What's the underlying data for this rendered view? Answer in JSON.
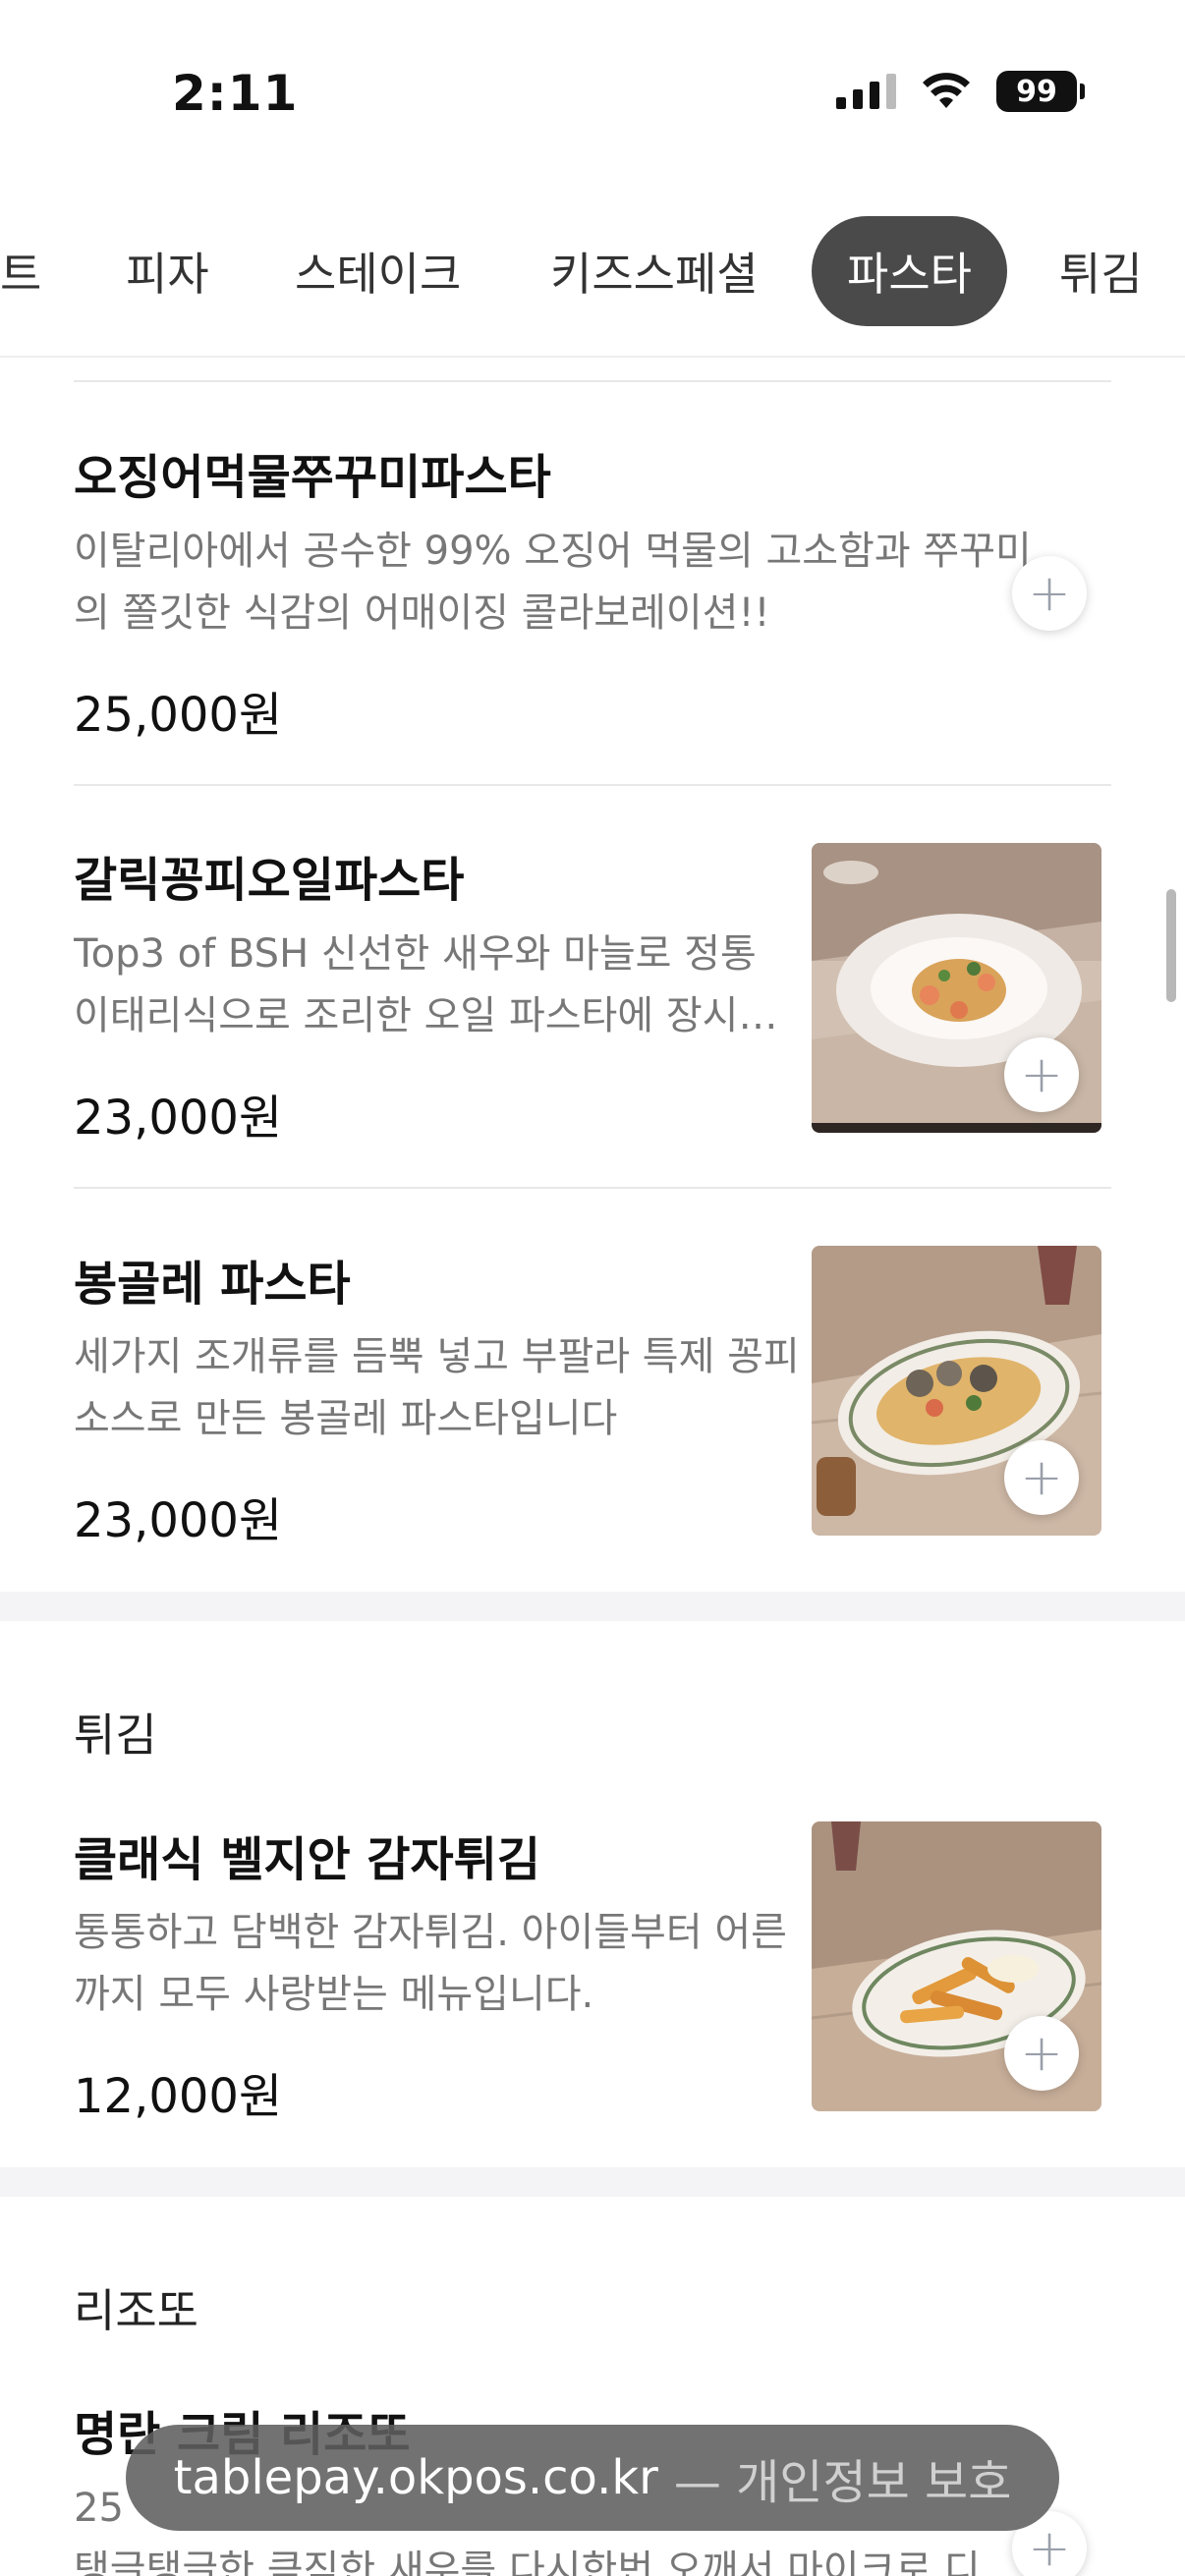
{
  "status_bar": {
    "time": "2:11",
    "battery": "99"
  },
  "tabs": [
    {
      "label": "트"
    },
    {
      "label": "피자"
    },
    {
      "label": "스테이크"
    },
    {
      "label": "키즈스페셜"
    },
    {
      "label": "파스타",
      "active": true
    },
    {
      "label": "튀김"
    }
  ],
  "menu": {
    "pasta_items": [
      {
        "name": "오징어먹물쭈꾸미파스타",
        "desc_line1": "이탈리아에서 공수한 99% 오징어 먹물의 고소함과 쭈꾸미",
        "desc_line2": "의 쫄깃한 식감의 어매이징 콜라보레이션!!",
        "price": "25,000원"
      },
      {
        "name": "갈릭꽁피오일파스타",
        "desc_line1": "Top3 of BSH 신선한 새우와 마늘로 정통",
        "desc_line2": "이태리식으로 조리한 오일 파스타에 장시…",
        "price": "23,000원"
      },
      {
        "name": "봉골레 파스타",
        "desc_line1": "세가지 조개류를 듬뿍 넣고 부팔라 특제 꽁피",
        "desc_line2": "소스로 만든 봉골레 파스타입니다",
        "price": "23,000원"
      }
    ],
    "fried_section": {
      "title": "튀김",
      "item": {
        "name": "클래식 벨지안 감자튀김",
        "desc_line1": "통통하고 담백한 감자튀김. 아이들부터 어른",
        "desc_line2": "까지 모두 사랑받는 메뉴입니다.",
        "price": "12,000원"
      }
    },
    "risotto_section": {
      "title": "리조또",
      "item": {
        "name": "명란 크림 리조또",
        "desc_line1": "25",
        "desc_line2": "탱글탱글한 큼직한 새우를 다시한번 오깨서 마이크로 디…"
      }
    }
  },
  "add_button_symbol": "+",
  "url_bar": {
    "domain": "tablepay.okpos.co.kr",
    "suffix": "— 개인정보 보호"
  }
}
